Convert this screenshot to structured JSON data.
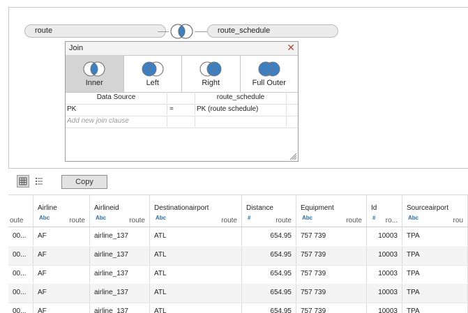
{
  "join_canvas": {
    "left_table": "route",
    "right_table": "route_schedule"
  },
  "join_dialog": {
    "title": "Join",
    "join_types": [
      {
        "label": "Inner",
        "selected": true
      },
      {
        "label": "Left",
        "selected": false
      },
      {
        "label": "Right",
        "selected": false
      },
      {
        "label": "Full Outer",
        "selected": false
      }
    ],
    "grid_headers": {
      "data_source": "Data Source",
      "right": "route_schedule"
    },
    "clauses": [
      {
        "left": "PK",
        "op": "=",
        "right": "PK (route schedule)"
      }
    ],
    "add_clause_placeholder": "Add new join clause"
  },
  "toolbar": {
    "copy_label": "Copy"
  },
  "data_grid": {
    "columns": [
      {
        "name": "",
        "type": "",
        "source": "oute"
      },
      {
        "name": "Airline",
        "type": "Abc",
        "source": "route"
      },
      {
        "name": "Airlineid",
        "type": "Abc",
        "source": "route"
      },
      {
        "name": "Destinationairport",
        "type": "Abc",
        "source": "route"
      },
      {
        "name": "Distance",
        "type": "#",
        "source": "route"
      },
      {
        "name": "Equipment",
        "type": "Abc",
        "source": "route"
      },
      {
        "name": "Id",
        "type": "#",
        "source": "ro..."
      },
      {
        "name": "Sourceairport",
        "type": "Abc",
        "source": "rou"
      }
    ],
    "rows": [
      [
        "00...",
        "AF",
        "airline_137",
        "ATL",
        "654.95",
        "757 739",
        "10003",
        "TPA"
      ],
      [
        "00...",
        "AF",
        "airline_137",
        "ATL",
        "654.95",
        "757 739",
        "10003",
        "TPA"
      ],
      [
        "00...",
        "AF",
        "airline_137",
        "ATL",
        "654.95",
        "757 739",
        "10003",
        "TPA"
      ],
      [
        "00...",
        "AF",
        "airline_137",
        "ATL",
        "654.95",
        "757 739",
        "10003",
        "TPA"
      ],
      [
        "00...",
        "AF",
        "airline_137",
        "ATL",
        "654.95",
        "757 739",
        "10003",
        "TPA"
      ]
    ]
  },
  "colors": {
    "venn_blue": "#3b7fc4",
    "close_red": "#b5463b",
    "selected_bg": "#d4d4d4"
  }
}
